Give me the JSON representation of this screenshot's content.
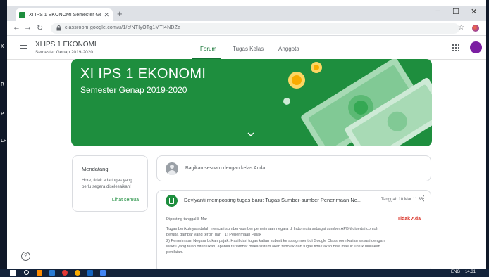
{
  "frame": {
    "left_marks": [
      "K",
      "R",
      "P",
      "LP"
    ]
  },
  "browser": {
    "tab_title": "XI IPS 1 EKONOMI Semester Ge",
    "new_tab": "+",
    "minimize": "−",
    "maximize": "☐",
    "close": "✕",
    "back": "←",
    "forward": "→",
    "reload": "↻",
    "url": "classroom.google.com/u/1/c/NTIyOTg1MTI4NDZa",
    "star": "☆"
  },
  "classroom": {
    "class_name": "XI IPS 1 EKONOMI",
    "class_subtitle": "Semester Genap 2019-2020",
    "tabs": [
      "Forum",
      "Tugas Kelas",
      "Anggota"
    ],
    "active_tab": "Forum",
    "avatar_letter": "I",
    "accent": "#1e8e3e"
  },
  "banner": {
    "title": "XI IPS 1 EKONOMI",
    "subtitle": "Semester Genap 2019-2020"
  },
  "upcoming": {
    "title": "Mendatang",
    "text": "Hore, tidak ada tugas yang perlu segera diselesaikan!",
    "link": "Lihat semua"
  },
  "announce": {
    "placeholder": "Bagikan sesuatu dengan kelas Anda..."
  },
  "post": {
    "title": "Devlyanti memposting tugas baru: Tugas Sumber-sumber Penerimaan Ne...",
    "date": "Tanggal: 10 Mar 11.36",
    "more": "⋮",
    "due": "Diposting tanggal 8 Mar",
    "status": "Tidak Ada",
    "body_lines": [
      "Tugas berikutnya adalah mencari sumber-sumber penerimaan negara di Indonesia sebagai sumber APBN disertai contoh",
      "berupa gambar yang terdiri dari : 1) Penerimaan Pajak",
      "2) Penerimaan Negara bukan pajak. Hasil dari tugas kalian submit ke assignment di Google Classroom kalian sesuai dengan",
      "waktu yang telah ditentukan, apabila terlambat maka sistem akan tertolak dan tugas tidak akan bisa masuk untuk dinilakan",
      "penilaian."
    ]
  },
  "help": "?",
  "taskbar": {
    "lang": "ENG",
    "time": "14.31"
  }
}
